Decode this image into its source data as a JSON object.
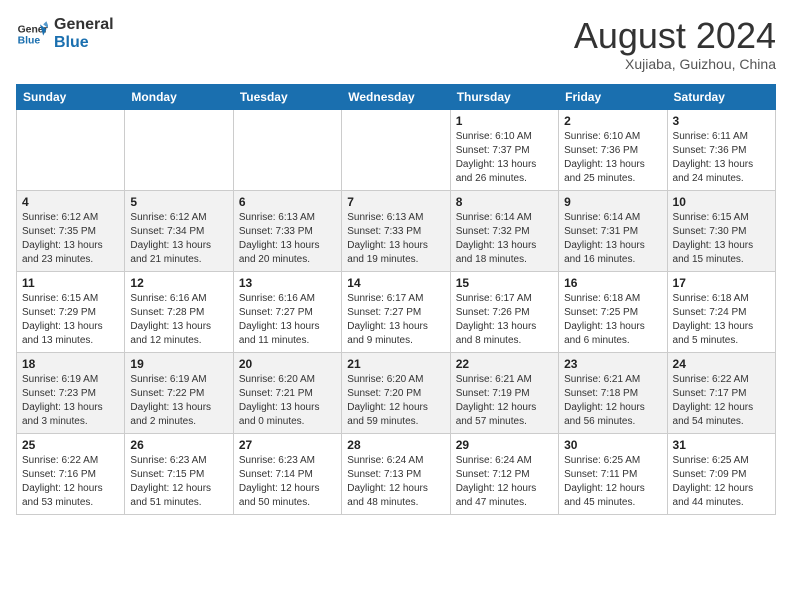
{
  "header": {
    "logo_line1": "General",
    "logo_line2": "Blue",
    "month": "August 2024",
    "location": "Xujiaba, Guizhou, China"
  },
  "weekdays": [
    "Sunday",
    "Monday",
    "Tuesday",
    "Wednesday",
    "Thursday",
    "Friday",
    "Saturday"
  ],
  "weeks": [
    [
      {
        "day": "",
        "info": ""
      },
      {
        "day": "",
        "info": ""
      },
      {
        "day": "",
        "info": ""
      },
      {
        "day": "",
        "info": ""
      },
      {
        "day": "1",
        "info": "Sunrise: 6:10 AM\nSunset: 7:37 PM\nDaylight: 13 hours\nand 26 minutes."
      },
      {
        "day": "2",
        "info": "Sunrise: 6:10 AM\nSunset: 7:36 PM\nDaylight: 13 hours\nand 25 minutes."
      },
      {
        "day": "3",
        "info": "Sunrise: 6:11 AM\nSunset: 7:36 PM\nDaylight: 13 hours\nand 24 minutes."
      }
    ],
    [
      {
        "day": "4",
        "info": "Sunrise: 6:12 AM\nSunset: 7:35 PM\nDaylight: 13 hours\nand 23 minutes."
      },
      {
        "day": "5",
        "info": "Sunrise: 6:12 AM\nSunset: 7:34 PM\nDaylight: 13 hours\nand 21 minutes."
      },
      {
        "day": "6",
        "info": "Sunrise: 6:13 AM\nSunset: 7:33 PM\nDaylight: 13 hours\nand 20 minutes."
      },
      {
        "day": "7",
        "info": "Sunrise: 6:13 AM\nSunset: 7:33 PM\nDaylight: 13 hours\nand 19 minutes."
      },
      {
        "day": "8",
        "info": "Sunrise: 6:14 AM\nSunset: 7:32 PM\nDaylight: 13 hours\nand 18 minutes."
      },
      {
        "day": "9",
        "info": "Sunrise: 6:14 AM\nSunset: 7:31 PM\nDaylight: 13 hours\nand 16 minutes."
      },
      {
        "day": "10",
        "info": "Sunrise: 6:15 AM\nSunset: 7:30 PM\nDaylight: 13 hours\nand 15 minutes."
      }
    ],
    [
      {
        "day": "11",
        "info": "Sunrise: 6:15 AM\nSunset: 7:29 PM\nDaylight: 13 hours\nand 13 minutes."
      },
      {
        "day": "12",
        "info": "Sunrise: 6:16 AM\nSunset: 7:28 PM\nDaylight: 13 hours\nand 12 minutes."
      },
      {
        "day": "13",
        "info": "Sunrise: 6:16 AM\nSunset: 7:27 PM\nDaylight: 13 hours\nand 11 minutes."
      },
      {
        "day": "14",
        "info": "Sunrise: 6:17 AM\nSunset: 7:27 PM\nDaylight: 13 hours\nand 9 minutes."
      },
      {
        "day": "15",
        "info": "Sunrise: 6:17 AM\nSunset: 7:26 PM\nDaylight: 13 hours\nand 8 minutes."
      },
      {
        "day": "16",
        "info": "Sunrise: 6:18 AM\nSunset: 7:25 PM\nDaylight: 13 hours\nand 6 minutes."
      },
      {
        "day": "17",
        "info": "Sunrise: 6:18 AM\nSunset: 7:24 PM\nDaylight: 13 hours\nand 5 minutes."
      }
    ],
    [
      {
        "day": "18",
        "info": "Sunrise: 6:19 AM\nSunset: 7:23 PM\nDaylight: 13 hours\nand 3 minutes."
      },
      {
        "day": "19",
        "info": "Sunrise: 6:19 AM\nSunset: 7:22 PM\nDaylight: 13 hours\nand 2 minutes."
      },
      {
        "day": "20",
        "info": "Sunrise: 6:20 AM\nSunset: 7:21 PM\nDaylight: 13 hours\nand 0 minutes."
      },
      {
        "day": "21",
        "info": "Sunrise: 6:20 AM\nSunset: 7:20 PM\nDaylight: 12 hours\nand 59 minutes."
      },
      {
        "day": "22",
        "info": "Sunrise: 6:21 AM\nSunset: 7:19 PM\nDaylight: 12 hours\nand 57 minutes."
      },
      {
        "day": "23",
        "info": "Sunrise: 6:21 AM\nSunset: 7:18 PM\nDaylight: 12 hours\nand 56 minutes."
      },
      {
        "day": "24",
        "info": "Sunrise: 6:22 AM\nSunset: 7:17 PM\nDaylight: 12 hours\nand 54 minutes."
      }
    ],
    [
      {
        "day": "25",
        "info": "Sunrise: 6:22 AM\nSunset: 7:16 PM\nDaylight: 12 hours\nand 53 minutes."
      },
      {
        "day": "26",
        "info": "Sunrise: 6:23 AM\nSunset: 7:15 PM\nDaylight: 12 hours\nand 51 minutes."
      },
      {
        "day": "27",
        "info": "Sunrise: 6:23 AM\nSunset: 7:14 PM\nDaylight: 12 hours\nand 50 minutes."
      },
      {
        "day": "28",
        "info": "Sunrise: 6:24 AM\nSunset: 7:13 PM\nDaylight: 12 hours\nand 48 minutes."
      },
      {
        "day": "29",
        "info": "Sunrise: 6:24 AM\nSunset: 7:12 PM\nDaylight: 12 hours\nand 47 minutes."
      },
      {
        "day": "30",
        "info": "Sunrise: 6:25 AM\nSunset: 7:11 PM\nDaylight: 12 hours\nand 45 minutes."
      },
      {
        "day": "31",
        "info": "Sunrise: 6:25 AM\nSunset: 7:09 PM\nDaylight: 12 hours\nand 44 minutes."
      }
    ]
  ]
}
